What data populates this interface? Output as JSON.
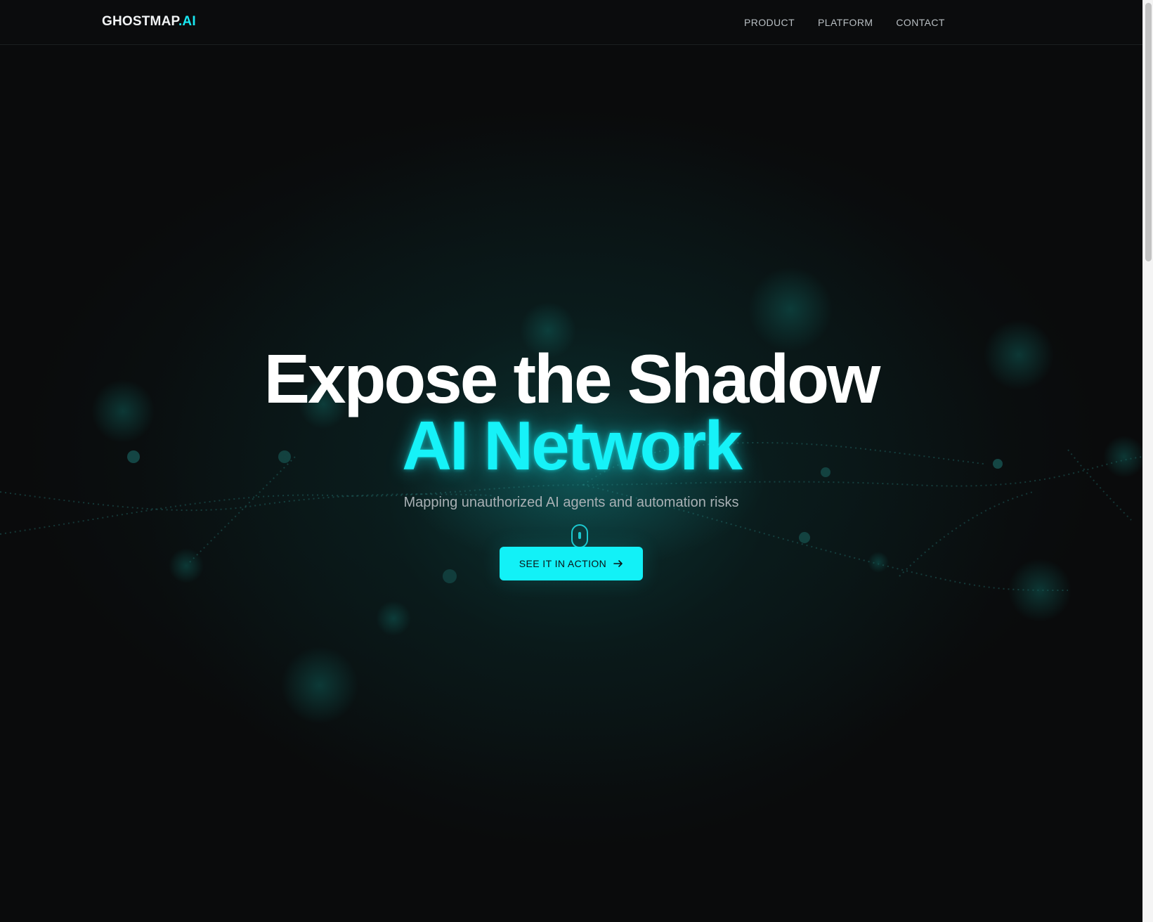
{
  "brand": {
    "name": "GHOSTMAP",
    "suffix": ".AI",
    "accent_color": "#19e6f0"
  },
  "nav": {
    "items": [
      {
        "label": "PRODUCT"
      },
      {
        "label": "PLATFORM"
      },
      {
        "label": "CONTACT"
      }
    ]
  },
  "hero": {
    "headline_line1": "Expose the Shadow",
    "headline_line2": "AI Network",
    "subtitle": "Mapping unauthorized AI agents and automation risks",
    "cta_label": "SEE IT IN ACTION",
    "cta_icon": "arrow-right-icon",
    "scroll_indicator_icon": "mouse-scroll-icon"
  },
  "colors": {
    "background": "#0a0b0c",
    "accent": "#12f1f7",
    "headline": "#ffffff",
    "subtitle": "#a8b0b4"
  }
}
